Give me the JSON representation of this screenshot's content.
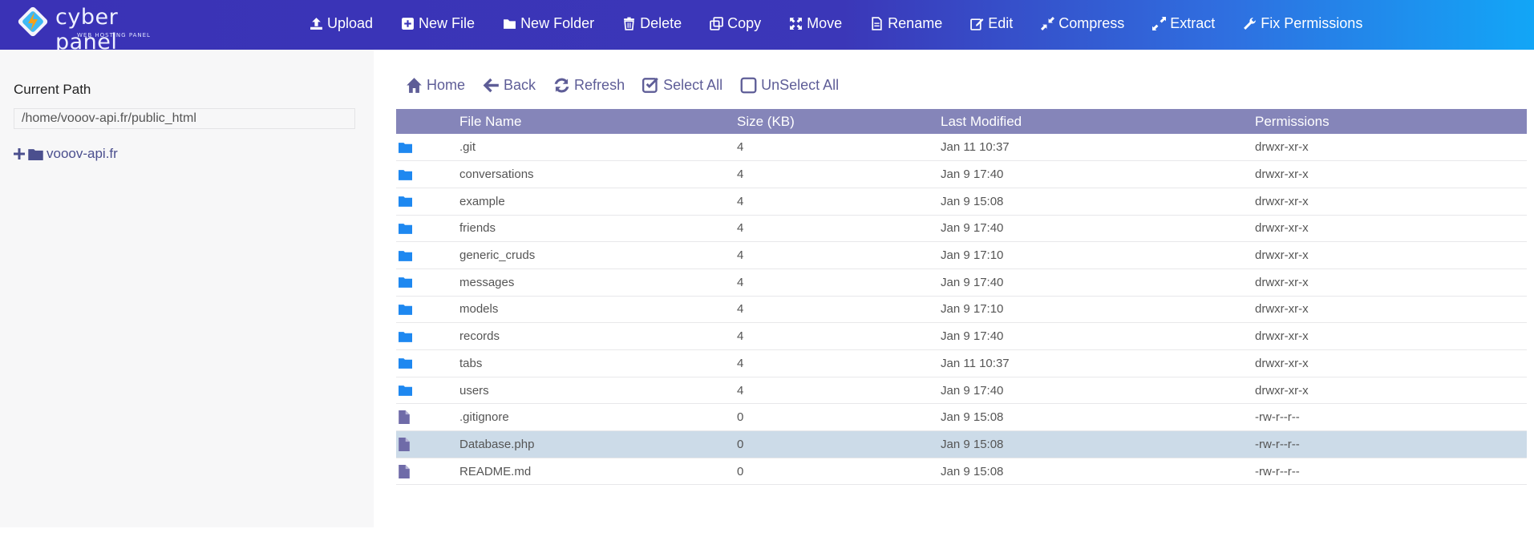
{
  "brand": {
    "name": "cyber panel",
    "subtitle": "WEB HOSTING PANEL"
  },
  "toolbar": {
    "upload": "Upload",
    "new_file": "New File",
    "new_folder": "New Folder",
    "delete": "Delete",
    "copy": "Copy",
    "move": "Move",
    "rename": "Rename",
    "edit": "Edit",
    "compress": "Compress",
    "extract": "Extract",
    "fix_permissions": "Fix Permissions"
  },
  "sidebar": {
    "current_path_label": "Current Path",
    "current_path_value": "/home/vooov-api.fr/public_html",
    "tree": [
      {
        "label": "vooov-api.fr",
        "icon": "folder-icon"
      }
    ]
  },
  "nav": {
    "home": "Home",
    "back": "Back",
    "refresh": "Refresh",
    "select_all": "Select All",
    "unselect_all": "UnSelect All"
  },
  "table": {
    "headers": {
      "name": "File Name",
      "size": "Size (KB)",
      "modified": "Last Modified",
      "permissions": "Permissions"
    },
    "rows": [
      {
        "type": "folder",
        "name": ".git",
        "size": "4",
        "modified": "Jan 11 10:37",
        "permissions": "drwxr-xr-x"
      },
      {
        "type": "folder",
        "name": "conversations",
        "size": "4",
        "modified": "Jan 9 17:40",
        "permissions": "drwxr-xr-x"
      },
      {
        "type": "folder",
        "name": "example",
        "size": "4",
        "modified": "Jan 9 15:08",
        "permissions": "drwxr-xr-x"
      },
      {
        "type": "folder",
        "name": "friends",
        "size": "4",
        "modified": "Jan 9 17:40",
        "permissions": "drwxr-xr-x"
      },
      {
        "type": "folder",
        "name": "generic_cruds",
        "size": "4",
        "modified": "Jan 9 17:10",
        "permissions": "drwxr-xr-x"
      },
      {
        "type": "folder",
        "name": "messages",
        "size": "4",
        "modified": "Jan 9 17:40",
        "permissions": "drwxr-xr-x"
      },
      {
        "type": "folder",
        "name": "models",
        "size": "4",
        "modified": "Jan 9 17:10",
        "permissions": "drwxr-xr-x"
      },
      {
        "type": "folder",
        "name": "records",
        "size": "4",
        "modified": "Jan 9 17:40",
        "permissions": "drwxr-xr-x"
      },
      {
        "type": "folder",
        "name": "tabs",
        "size": "4",
        "modified": "Jan 11 10:37",
        "permissions": "drwxr-xr-x"
      },
      {
        "type": "folder",
        "name": "users",
        "size": "4",
        "modified": "Jan 9 17:40",
        "permissions": "drwxr-xr-x"
      },
      {
        "type": "file",
        "name": ".gitignore",
        "size": "0",
        "modified": "Jan 9 15:08",
        "permissions": "-rw-r--r--"
      },
      {
        "type": "file",
        "name": "Database.php",
        "size": "0",
        "modified": "Jan 9 15:08",
        "permissions": "-rw-r--r--",
        "selected": true
      },
      {
        "type": "file",
        "name": "README.md",
        "size": "0",
        "modified": "Jan 9 15:08",
        "permissions": "-rw-r--r--"
      }
    ]
  },
  "colors": {
    "topbar_start": "#3a32b6",
    "topbar_end": "#12a6f7",
    "folder_icon": "#1e88f0",
    "file_icon": "#6f6ba8",
    "header_row": "#8585b9",
    "selected_row": "#ccdbe8"
  }
}
